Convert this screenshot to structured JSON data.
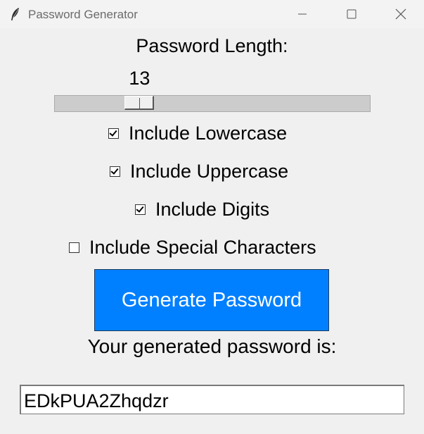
{
  "window": {
    "title": "Password Generator",
    "icons": {
      "app": "feather-icon",
      "minimize": "minimize-icon",
      "maximize": "maximize-icon",
      "close": "close-icon"
    }
  },
  "length": {
    "label": "Password Length:",
    "value": "13",
    "min": 1,
    "max": 50,
    "current": 13
  },
  "options": {
    "lowercase": {
      "label": "Include Lowercase",
      "checked": true
    },
    "uppercase": {
      "label": "Include Uppercase",
      "checked": true
    },
    "digits": {
      "label": "Include Digits",
      "checked": true
    },
    "special": {
      "label": "Include Special Characters",
      "checked": false
    }
  },
  "generate_button": {
    "label": "Generate Password",
    "color": "#0080ff",
    "text_color": "#ffffff"
  },
  "result": {
    "label": "Your generated password is:",
    "password": "EDkPUA2Zhqdzr"
  }
}
